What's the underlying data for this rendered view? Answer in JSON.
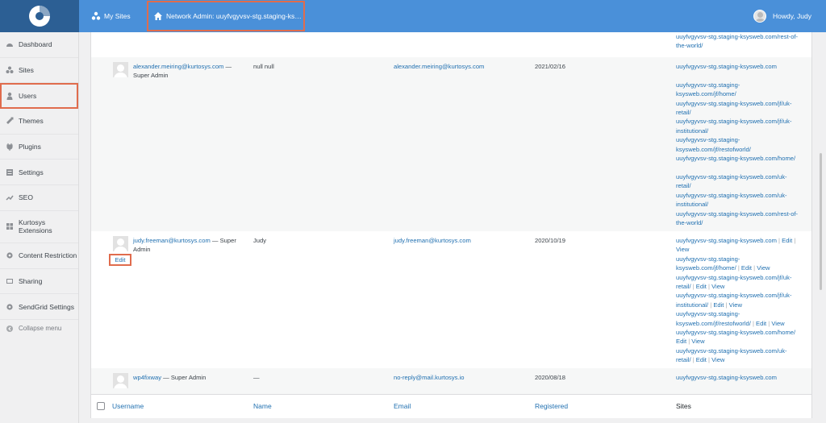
{
  "adminbar": {
    "my_sites": "My Sites",
    "network_admin": "Network Admin: uuyfvgyvsv-stg.staging-ks…",
    "howdy": "Howdy, Judy"
  },
  "sidebar": {
    "items": [
      {
        "label": "Dashboard",
        "icon": "dashboard-icon"
      },
      {
        "label": "Sites",
        "icon": "sites-icon"
      },
      {
        "label": "Users",
        "icon": "users-icon"
      },
      {
        "label": "Themes",
        "icon": "themes-icon"
      },
      {
        "label": "Plugins",
        "icon": "plugins-icon"
      },
      {
        "label": "Settings",
        "icon": "settings-icon"
      },
      {
        "label": "SEO",
        "icon": "seo-icon"
      },
      {
        "label_line1": "Kurtosys",
        "label_line2": "Extensions",
        "icon": "kurtosys-icon"
      },
      {
        "label": "Content Restriction",
        "icon": "gear-icon"
      },
      {
        "label": "Sharing",
        "icon": "sharing-icon"
      },
      {
        "label": "SendGrid Settings",
        "icon": "gear-icon"
      },
      {
        "label": "Collapse menu",
        "icon": "collapse-icon"
      }
    ]
  },
  "table": {
    "top_fragment": {
      "sites": [
        "uuyfvgyvsv-stg.staging-ksysweb.com/rest-of-",
        "the-world/"
      ]
    },
    "rows": [
      {
        "username": "alexander.meiring@kurtosys.com",
        "role": "— Super Admin",
        "name": "null null",
        "email": "alexander.meiring@kurtosys.com",
        "registered": "2021/02/16",
        "sites": [
          "uuyfvgyvsv-stg.staging-ksysweb.com",
          "",
          "uuyfvgyvsv-stg.staging-",
          "ksysweb.com/jf/home/",
          "uuyfvgyvsv-stg.staging-ksysweb.com/jf/uk-",
          "retail/",
          "uuyfvgyvsv-stg.staging-ksysweb.com/jf/uk-",
          "institutional/",
          "uuyfvgyvsv-stg.staging-",
          "ksysweb.com/jf/restofworld/",
          "uuyfvgyvsv-stg.staging-ksysweb.com/home/",
          "",
          "uuyfvgyvsv-stg.staging-ksysweb.com/uk-",
          "retail/",
          "uuyfvgyvsv-stg.staging-ksysweb.com/uk-",
          "institutional/",
          "uuyfvgyvsv-stg.staging-ksysweb.com/rest-of-",
          "the-world/"
        ]
      },
      {
        "username": "judy.freeman@kurtosys.com",
        "role_line1": "— Super",
        "role_line2": "Admin",
        "edit": "Edit",
        "name": "Judy",
        "email": "judy.freeman@kurtosys.com",
        "registered": "2020/10/19",
        "sites": [
          {
            "url": "uuyfvgyvsv-stg.staging-ksysweb.com",
            "edit": "Edit",
            "view": ""
          },
          {
            "url": "",
            "edit": "",
            "view": "View"
          },
          {
            "url": "uuyfvgyvsv-stg.staging-",
            "edit": "",
            "view": ""
          },
          {
            "url": "ksysweb.com/jf/home/",
            "edit": "Edit",
            "view": "View"
          },
          {
            "url": "uuyfvgyvsv-stg.staging-ksysweb.com/jf/uk-",
            "edit": "",
            "view": ""
          },
          {
            "url": "retail/",
            "edit": "Edit",
            "view": "View"
          },
          {
            "url": "uuyfvgyvsv-stg.staging-ksysweb.com/jf/uk-",
            "edit": "",
            "view": ""
          },
          {
            "url": "institutional/",
            "edit": "Edit",
            "view": "View"
          },
          {
            "url": "uuyfvgyvsv-stg.staging-",
            "edit": "",
            "view": ""
          },
          {
            "url": "ksysweb.com/jf/restofworld/",
            "edit": "Edit",
            "view": "View"
          },
          {
            "url": "uuyfvgyvsv-stg.staging-ksysweb.com/home/",
            "edit": "",
            "view": ""
          },
          {
            "url": "",
            "edit": "Edit",
            "view": "View"
          },
          {
            "url": "uuyfvgyvsv-stg.staging-ksysweb.com/uk-",
            "edit": "",
            "view": ""
          },
          {
            "url": "retail/",
            "edit": "Edit",
            "view": "View"
          }
        ]
      },
      {
        "username": "wp4fixway",
        "role": "— Super Admin",
        "name": "—",
        "email": "no-reply@mail.kurtosys.io",
        "registered": "2020/08/18",
        "sites": [
          "uuyfvgyvsv-stg.staging-ksysweb.com"
        ]
      }
    ],
    "footer": {
      "username": "Username",
      "name": "Name",
      "email": "Email",
      "registered": "Registered",
      "sites": "Sites"
    }
  }
}
